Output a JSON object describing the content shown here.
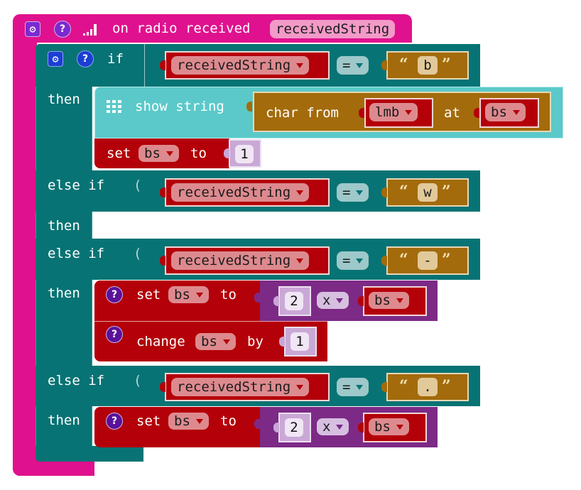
{
  "event": {
    "title": "on radio received",
    "param": "receivedString",
    "gear_icon": "gear-icon",
    "help_icon": "help-icon",
    "signal_icon": "signal-bars-icon",
    "color": "#e0118e"
  },
  "ifblock": {
    "color": "#087374",
    "if_label": "if",
    "then_label": "then",
    "else_if_label": "else if",
    "branches": [
      {
        "label": "if",
        "condition": {
          "left": "receivedString",
          "op": "=",
          "right": "b"
        },
        "then": [
          {
            "type": "show string",
            "label": "show string",
            "arg": {
              "label_char": "char from",
              "string_var": "lmb",
              "label_at": "at",
              "index_var": "bs"
            }
          },
          {
            "type": "set",
            "label_set": "set",
            "var": "bs",
            "label_to": "to",
            "value": "1"
          }
        ]
      },
      {
        "label": "else if",
        "condition": {
          "left": "receivedString",
          "op": "=",
          "right": "w"
        },
        "then": []
      },
      {
        "label": "else if",
        "condition": {
          "left": "receivedString",
          "op": "=",
          "right": "-"
        },
        "then": [
          {
            "type": "set",
            "label_set": "set",
            "var": "bs",
            "label_to": "to",
            "expr": {
              "left": "2",
              "op": "x",
              "right": "bs"
            }
          },
          {
            "type": "change",
            "label_change": "change",
            "var": "bs",
            "label_by": "by",
            "value": "1"
          }
        ]
      },
      {
        "label": "else if",
        "condition": {
          "left": "receivedString",
          "op": "=",
          "right": "."
        },
        "then": [
          {
            "type": "set",
            "label_set": "set",
            "var": "bs",
            "label_to": "to",
            "expr": {
              "left": "2",
              "op": "x",
              "right": "bs"
            }
          }
        ]
      }
    ]
  }
}
